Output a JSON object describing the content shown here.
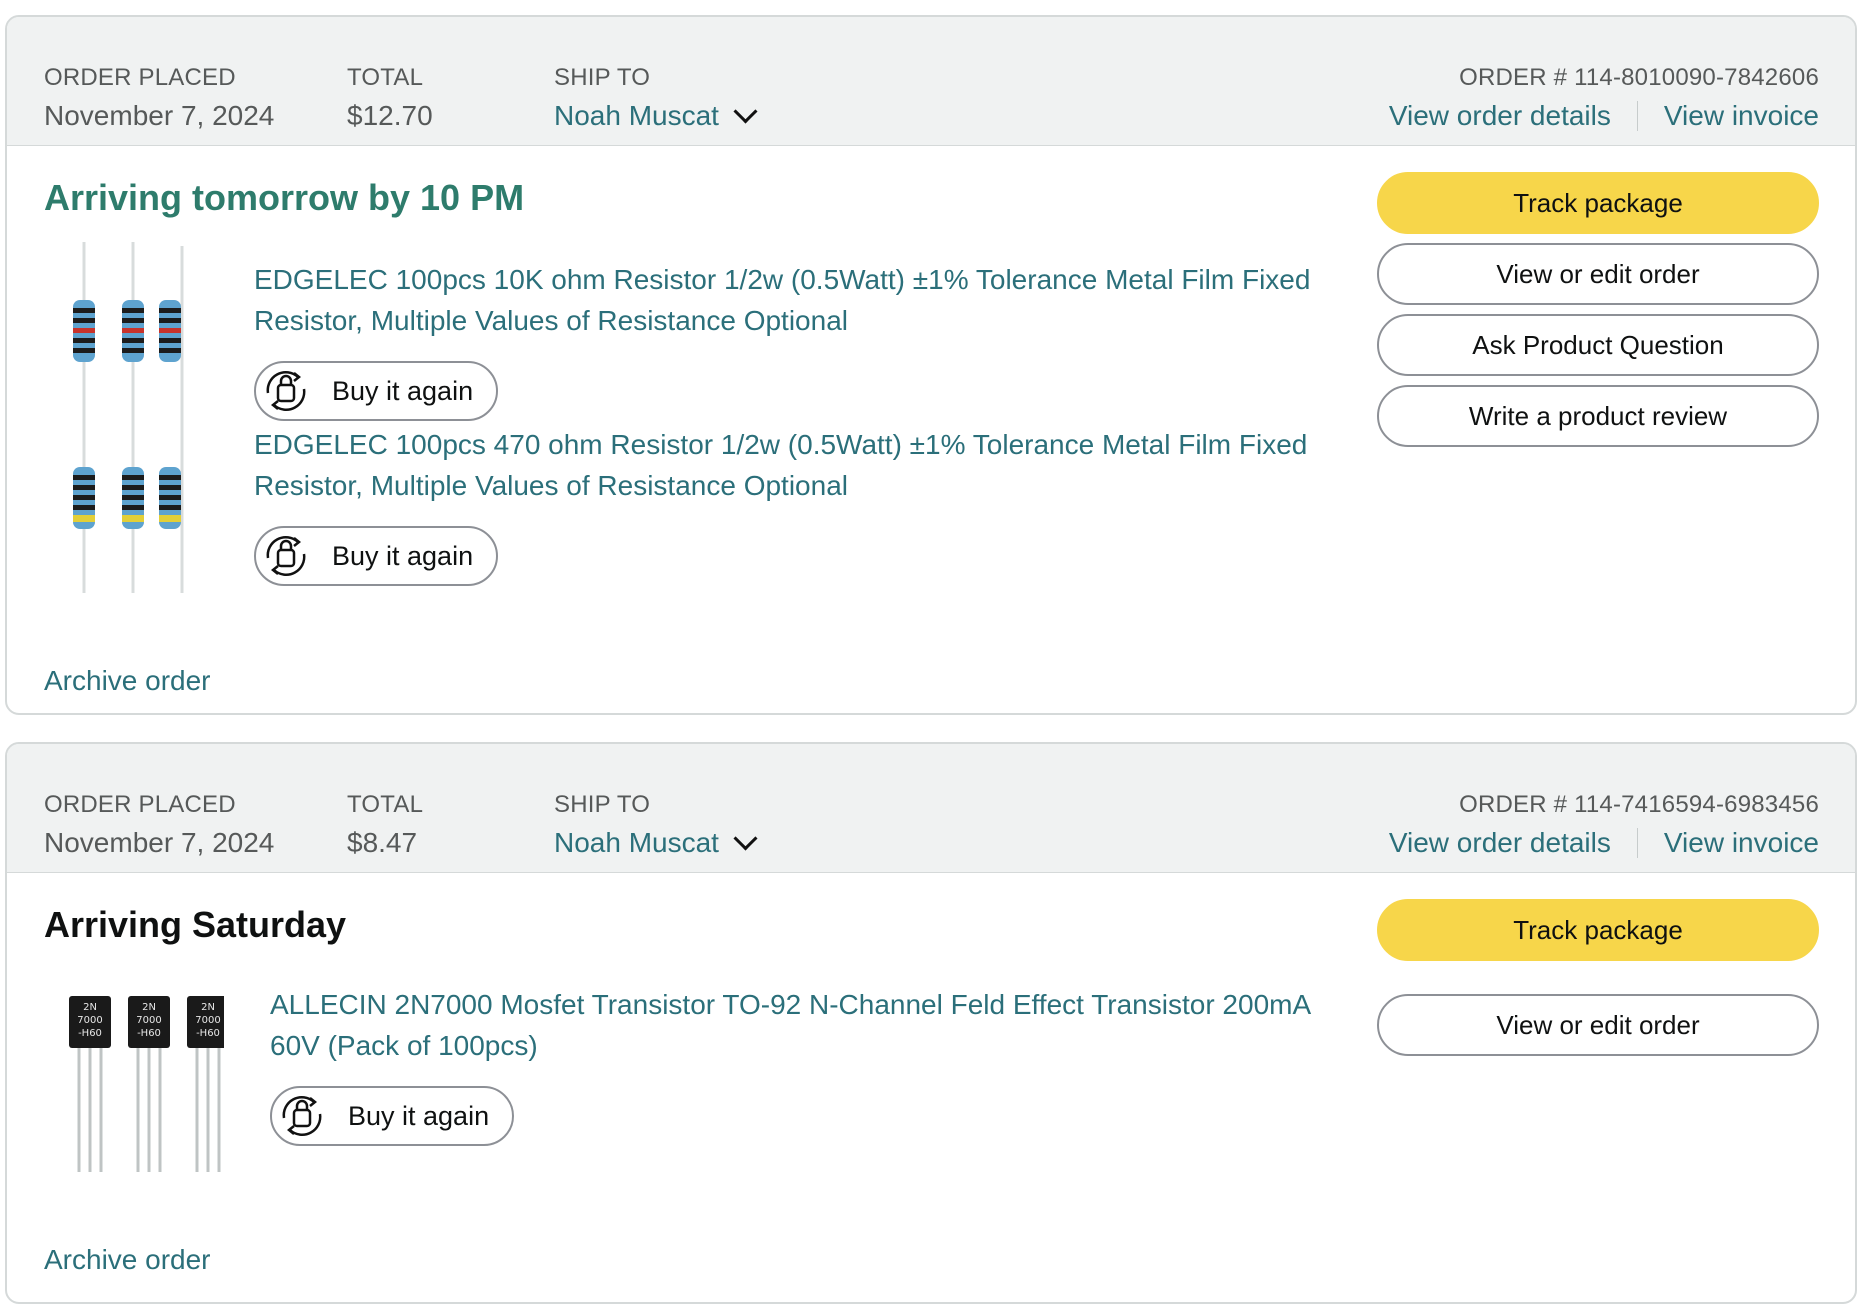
{
  "orders": [
    {
      "header": {
        "placed_label": "ORDER PLACED",
        "placed_value": "November 7, 2024",
        "total_label": "TOTAL",
        "total_value": "$12.70",
        "ship_label": "SHIP TO",
        "ship_value": "Noah Muscat",
        "order_number": "ORDER # 114-8010090-7842606",
        "view_details": "View order details",
        "view_invoice": "View invoice"
      },
      "status": "Arriving tomorrow by 10 PM",
      "items": [
        {
          "title_line1": "EDGELEC 100pcs 10K ohm Resistor 1/2w (0.5Watt) ±1% Tolerance Metal Film Fixed",
          "title_line2": "Resistor, Multiple Values of Resistance Optional",
          "buy_again": "Buy it again"
        },
        {
          "title_line1": "EDGELEC 100pcs 470 ohm Resistor 1/2w (0.5Watt) ±1% Tolerance Metal Film Fixed",
          "title_line2": "Resistor, Multiple Values of Resistance Optional",
          "buy_again": "Buy it again"
        }
      ],
      "actions": [
        "Track package",
        "View or edit order",
        "Ask Product Question",
        "Write a product review"
      ],
      "archive": "Archive order"
    },
    {
      "header": {
        "placed_label": "ORDER PLACED",
        "placed_value": "November 7, 2024",
        "total_label": "TOTAL",
        "total_value": "$8.47",
        "ship_label": "SHIP TO",
        "ship_value": "Noah Muscat",
        "order_number": "ORDER # 114-7416594-6983456",
        "view_details": "View order details",
        "view_invoice": "View invoice"
      },
      "status": "Arriving Saturday",
      "items": [
        {
          "title_line1": "ALLECIN 2N7000 Mosfet Transistor TO-92 N-Channel Feld Effect Transistor 200mA",
          "title_line2": "60V (Pack of 100pcs)",
          "buy_again": "Buy it again",
          "package_label": [
            "2N",
            "7000",
            "-H60"
          ]
        }
      ],
      "actions": [
        "Track package",
        "View or edit order"
      ],
      "archive": "Archive order"
    }
  ],
  "colors": {
    "link": "#2b6f7a",
    "status_green": "#2e7c6c",
    "primary_button": "#f7d64a",
    "header_bg": "#f0f2f2"
  },
  "icons": {
    "ship_dropdown": "chevron-down-icon",
    "buy_again": "buy-again-icon",
    "resistor_thumb": "resistor-image",
    "transistor_thumb": "transistor-image"
  }
}
